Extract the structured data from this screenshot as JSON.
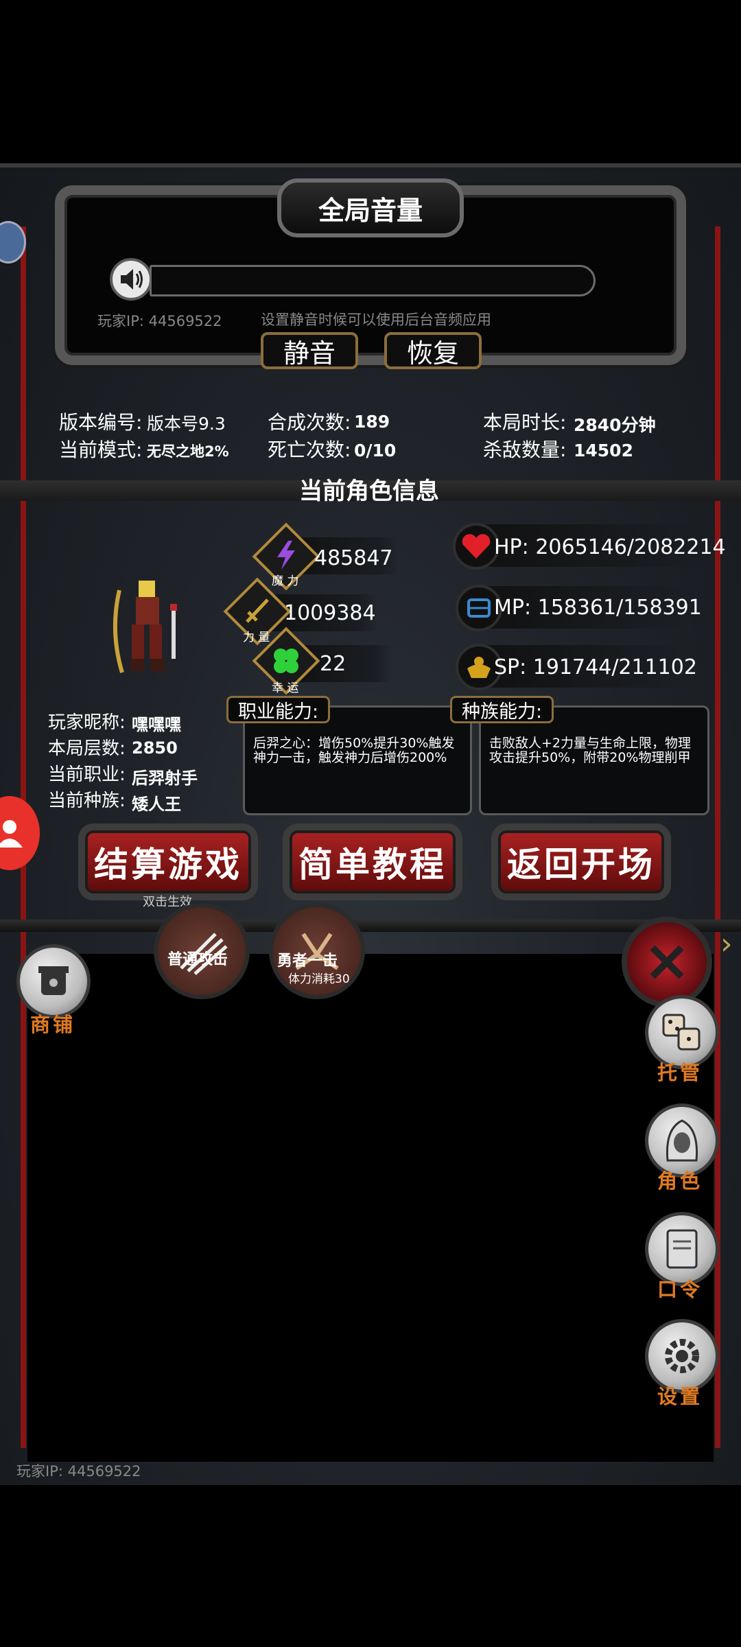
{
  "volume": {
    "title": "全局音量",
    "player_ip_label": "玩家IP:",
    "player_ip": "44569522",
    "hint": "设置静音时候可以使用后台音频应用",
    "mute_label": "静音",
    "restore_label": "恢复"
  },
  "game_stats": {
    "version_label": "版本编号:",
    "version_value": "版本号9.3",
    "mode_label": "当前模式:",
    "mode_value": "无尽之地2%",
    "craft_label": "合成次数:",
    "craft_value": "189",
    "death_label": "死亡次数:",
    "death_value": "0/10",
    "duration_label": "本局时长:",
    "duration_value": "2840分钟",
    "kills_label": "杀敌数量:",
    "kills_value": "14502"
  },
  "character": {
    "section_title": "当前角色信息",
    "attributes": [
      {
        "caption": "魔 力",
        "value": "485847",
        "icon": "lightning-icon"
      },
      {
        "caption": "力 量",
        "value": "1009384",
        "icon": "sword-icon"
      },
      {
        "caption": "幸 运",
        "value": "22",
        "icon": "clover-icon"
      }
    ],
    "hp_label": "HP:",
    "hp_value": "2065146/2082214",
    "mp_label": "MP:",
    "mp_value": "158361/158391",
    "sp_label": "SP:",
    "sp_value": "191744/211102",
    "nickname_label": "玩家昵称:",
    "nickname_value": "嘿嘿嘿",
    "floor_label": "本局层数:",
    "floor_value": "2850",
    "class_label": "当前职业:",
    "class_value": "后羿射手",
    "race_label": "当前种族:",
    "race_value": "矮人王",
    "class_ability_title": "职业能力:",
    "class_ability_text": "后羿之心：增伤50%提升30%触发神力一击，触发神力后增伤200%",
    "race_ability_title": "种族能力:",
    "race_ability_text": "击败敌人+2力量与生命上限，物理攻击提升50%，附带20%物理削甲"
  },
  "actions": {
    "settle_label": "结算游戏",
    "settle_sub": "双击生效",
    "tutorial_label": "简单教程",
    "return_label": "返回开场"
  },
  "skills": {
    "normal_attack": "普通攻击",
    "brave_strike": "勇者一击",
    "brave_cost": "体力消耗30"
  },
  "side_menu": {
    "shop": "商铺",
    "auto": "托管",
    "role": "角色",
    "code": "口令",
    "settings": "设置"
  },
  "footer": {
    "player_ip_label": "玩家IP:",
    "player_ip": "44569522"
  },
  "colors": {
    "accent_orange": "#e07a22",
    "frame_red": "#8a1414",
    "gold_border": "#8b6e3b"
  }
}
